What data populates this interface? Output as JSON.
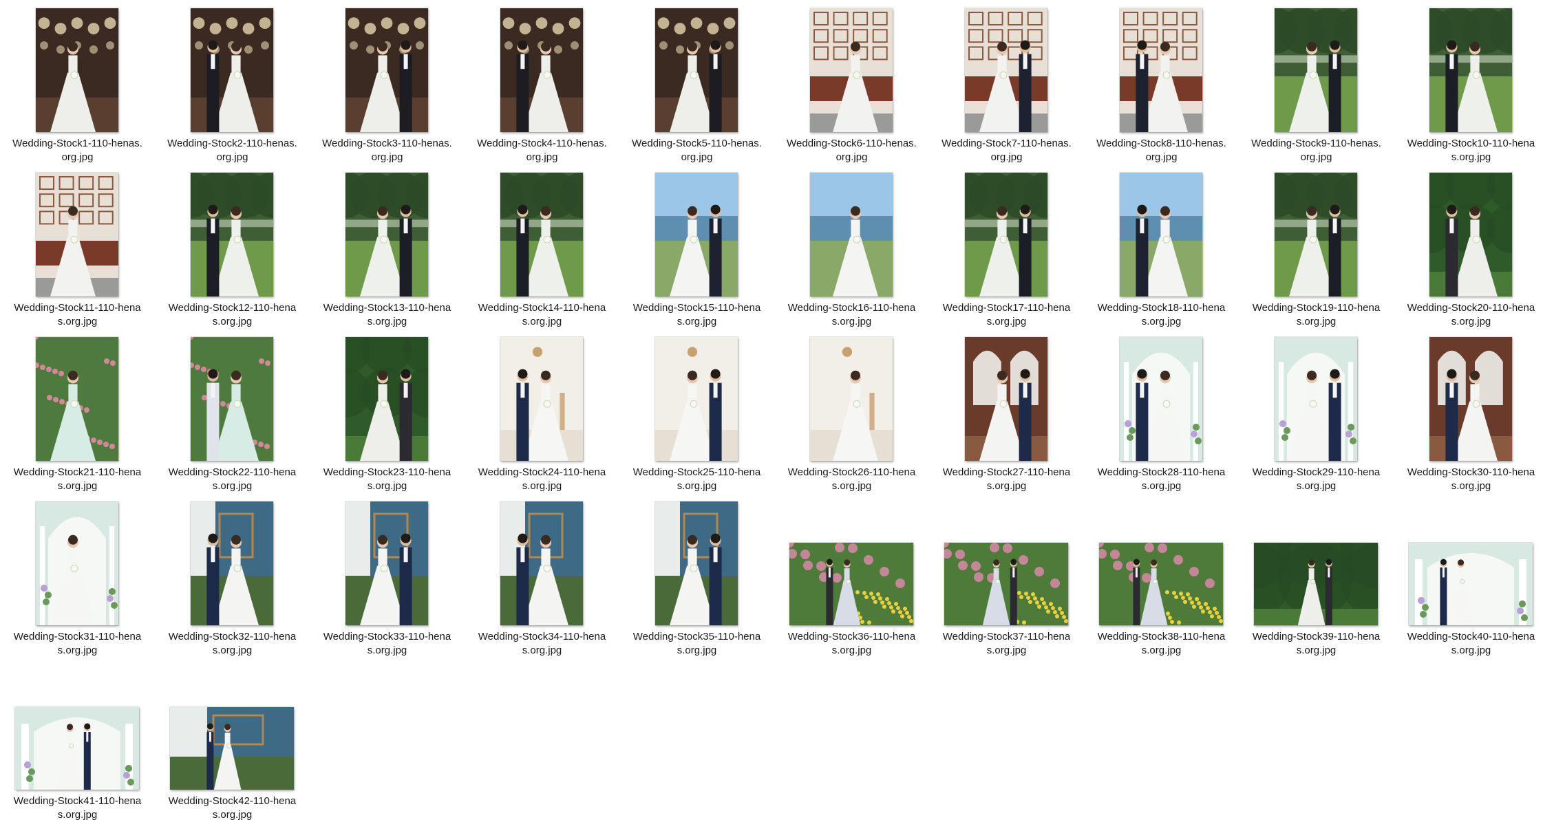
{
  "window": {
    "view": "large-icons"
  },
  "files": [
    {
      "line1": "Wedding-Stock1-110-henas.",
      "line2": "org.jpg",
      "orientation": "portrait",
      "scene": "chandelier-dark"
    },
    {
      "line1": "Wedding-Stock2-110-henas.",
      "line2": "org.jpg",
      "orientation": "portrait",
      "scene": "chandelier-dark"
    },
    {
      "line1": "Wedding-Stock3-110-henas.",
      "line2": "org.jpg",
      "orientation": "portrait",
      "scene": "chandelier-dark"
    },
    {
      "line1": "Wedding-Stock4-110-henas.",
      "line2": "org.jpg",
      "orientation": "portrait",
      "scene": "chandelier-dark"
    },
    {
      "line1": "Wedding-Stock5-110-henas.",
      "line2": "org.jpg",
      "orientation": "portrait",
      "scene": "chandelier-dark"
    },
    {
      "line1": "Wedding-Stock6-110-henas.",
      "line2": "org.jpg",
      "orientation": "portrait",
      "scene": "frames-wall"
    },
    {
      "line1": "Wedding-Stock7-110-henas.",
      "line2": "org.jpg",
      "orientation": "portrait",
      "scene": "frames-wall"
    },
    {
      "line1": "Wedding-Stock8-110-henas.",
      "line2": "org.jpg",
      "orientation": "portrait",
      "scene": "frames-wall"
    },
    {
      "line1": "Wedding-Stock9-110-henas.",
      "line2": "org.jpg",
      "orientation": "portrait",
      "scene": "trees-park"
    },
    {
      "line1": "Wedding-Stock10-110-hena",
      "line2": "s.org.jpg",
      "orientation": "portrait",
      "scene": "trees-park"
    },
    {
      "line1": "Wedding-Stock11-110-hena",
      "line2": "s.org.jpg",
      "orientation": "portrait",
      "scene": "frames-wall"
    },
    {
      "line1": "Wedding-Stock12-110-hena",
      "line2": "s.org.jpg",
      "orientation": "portrait",
      "scene": "trees-park"
    },
    {
      "line1": "Wedding-Stock13-110-hena",
      "line2": "s.org.jpg",
      "orientation": "portrait",
      "scene": "trees-park"
    },
    {
      "line1": "Wedding-Stock14-110-hena",
      "line2": "s.org.jpg",
      "orientation": "portrait",
      "scene": "trees-park"
    },
    {
      "line1": "Wedding-Stock15-110-hena",
      "line2": "s.org.jpg",
      "orientation": "portrait",
      "scene": "sky-lake"
    },
    {
      "line1": "Wedding-Stock16-110-hena",
      "line2": "s.org.jpg",
      "orientation": "portrait",
      "scene": "sky-lake"
    },
    {
      "line1": "Wedding-Stock17-110-hena",
      "line2": "s.org.jpg",
      "orientation": "portrait",
      "scene": "trees-park"
    },
    {
      "line1": "Wedding-Stock18-110-hena",
      "line2": "s.org.jpg",
      "orientation": "portrait",
      "scene": "sky-lake"
    },
    {
      "line1": "Wedding-Stock19-110-hena",
      "line2": "s.org.jpg",
      "orientation": "portrait",
      "scene": "trees-park"
    },
    {
      "line1": "Wedding-Stock20-110-hena",
      "line2": "s.org.jpg",
      "orientation": "portrait",
      "scene": "green-hedge"
    },
    {
      "line1": "Wedding-Stock21-110-hena",
      "line2": "s.org.jpg",
      "orientation": "portrait",
      "scene": "pink-flowers"
    },
    {
      "line1": "Wedding-Stock22-110-hena",
      "line2": "s.org.jpg",
      "orientation": "portrait",
      "scene": "pink-flowers"
    },
    {
      "line1": "Wedding-Stock23-110-hena",
      "line2": "s.org.jpg",
      "orientation": "portrait",
      "scene": "green-hedge"
    },
    {
      "line1": "Wedding-Stock24-110-hena",
      "line2": "s.org.jpg",
      "orientation": "portrait",
      "scene": "white-studio"
    },
    {
      "line1": "Wedding-Stock25-110-hena",
      "line2": "s.org.jpg",
      "orientation": "portrait",
      "scene": "white-studio"
    },
    {
      "line1": "Wedding-Stock26-110-hena",
      "line2": "s.org.jpg",
      "orientation": "portrait",
      "scene": "white-studio"
    },
    {
      "line1": "Wedding-Stock27-110-hena",
      "line2": "s.org.jpg",
      "orientation": "portrait",
      "scene": "arch-windows"
    },
    {
      "line1": "Wedding-Stock28-110-hena",
      "line2": "s.org.jpg",
      "orientation": "portrait",
      "scene": "white-arches"
    },
    {
      "line1": "Wedding-Stock29-110-hena",
      "line2": "s.org.jpg",
      "orientation": "portrait",
      "scene": "white-arches"
    },
    {
      "line1": "Wedding-Stock30-110-hena",
      "line2": "s.org.jpg",
      "orientation": "portrait",
      "scene": "arch-windows"
    },
    {
      "line1": "Wedding-Stock31-110-hena",
      "line2": "s.org.jpg",
      "orientation": "portrait",
      "scene": "white-arches"
    },
    {
      "line1": "Wedding-Stock32-110-hena",
      "line2": "s.org.jpg",
      "orientation": "portrait",
      "scene": "blue-wall"
    },
    {
      "line1": "Wedding-Stock33-110-hena",
      "line2": "s.org.jpg",
      "orientation": "portrait",
      "scene": "blue-wall"
    },
    {
      "line1": "Wedding-Stock34-110-hena",
      "line2": "s.org.jpg",
      "orientation": "portrait",
      "scene": "blue-wall"
    },
    {
      "line1": "Wedding-Stock35-110-hena",
      "line2": "s.org.jpg",
      "orientation": "portrait",
      "scene": "blue-wall"
    },
    {
      "line1": "Wedding-Stock36-110-hena",
      "line2": "s.org.jpg",
      "orientation": "landscape",
      "scene": "yellow-flowers"
    },
    {
      "line1": "Wedding-Stock37-110-hena",
      "line2": "s.org.jpg",
      "orientation": "landscape",
      "scene": "yellow-flowers"
    },
    {
      "line1": "Wedding-Stock38-110-hena",
      "line2": "s.org.jpg",
      "orientation": "landscape",
      "scene": "yellow-flowers"
    },
    {
      "line1": "Wedding-Stock39-110-hena",
      "line2": "s.org.jpg",
      "orientation": "landscape",
      "scene": "green-hedge"
    },
    {
      "line1": "Wedding-Stock40-110-hena",
      "line2": "s.org.jpg",
      "orientation": "landscape",
      "scene": "white-arches"
    },
    {
      "line1": "Wedding-Stock41-110-hena",
      "line2": "s.org.jpg",
      "orientation": "landscape",
      "scene": "white-arches"
    },
    {
      "line1": "Wedding-Stock42-110-hena",
      "line2": "s.org.jpg",
      "orientation": "landscape",
      "scene": "blue-wall"
    }
  ],
  "scene_palettes": {
    "chandelier-dark": {
      "bg": "#3a2a22",
      "floor": "#5a3e30",
      "accent": "#f2e2b8",
      "suit": "#1c1c22",
      "dress": "#eeeeea"
    },
    "frames-wall": {
      "bg": "#e8e0d6",
      "floor": "#7a3a2a",
      "accent": "#8a5a40",
      "suit": "#1e2230",
      "dress": "#f2f2f0"
    },
    "trees-park": {
      "bg": "#3f5e36",
      "floor": "#6f9a4a",
      "accent": "#c8d8c0",
      "suit": "#1c1e26",
      "dress": "#eef0ec"
    },
    "sky-lake": {
      "bg": "#9cc6e8",
      "floor": "#8aa868",
      "accent": "#5f8fb0",
      "suit": "#1e2230",
      "dress": "#f4f4f2"
    },
    "green-hedge": {
      "bg": "#2f5a2a",
      "floor": "#4a7a38",
      "accent": "#6a9a50",
      "suit": "#2a2a30",
      "dress": "#eeeeea"
    },
    "pink-flowers": {
      "bg": "#4f7a3e",
      "floor": "#6a8a48",
      "accent": "#e08aa0",
      "suit": "#e0e4ea",
      "dress": "#d8ece6"
    },
    "white-studio": {
      "bg": "#f2efe8",
      "floor": "#e6e0d4",
      "accent": "#c8a070",
      "suit": "#1e2a4a",
      "dress": "#f6f6f4"
    },
    "arch-windows": {
      "bg": "#6a3a2a",
      "floor": "#8a5a40",
      "accent": "#f0f0ea",
      "suit": "#1e2a4a",
      "dress": "#f4f4f2"
    },
    "white-arches": {
      "bg": "#d8e8e2",
      "floor": "#cfd8d2",
      "accent": "#f6f8f6",
      "suit": "#1e2a4a",
      "dress": "#f6f6f4"
    },
    "blue-wall": {
      "bg": "#3f6a86",
      "floor": "#4a6a3a",
      "accent": "#f0f0ea",
      "suit": "#1e2a4a",
      "dress": "#f4f4f2"
    },
    "yellow-flowers": {
      "bg": "#4e7a3a",
      "floor": "#c8c048",
      "accent": "#e8d040",
      "suit": "#2a2a30",
      "dress": "#d8dce6"
    }
  }
}
